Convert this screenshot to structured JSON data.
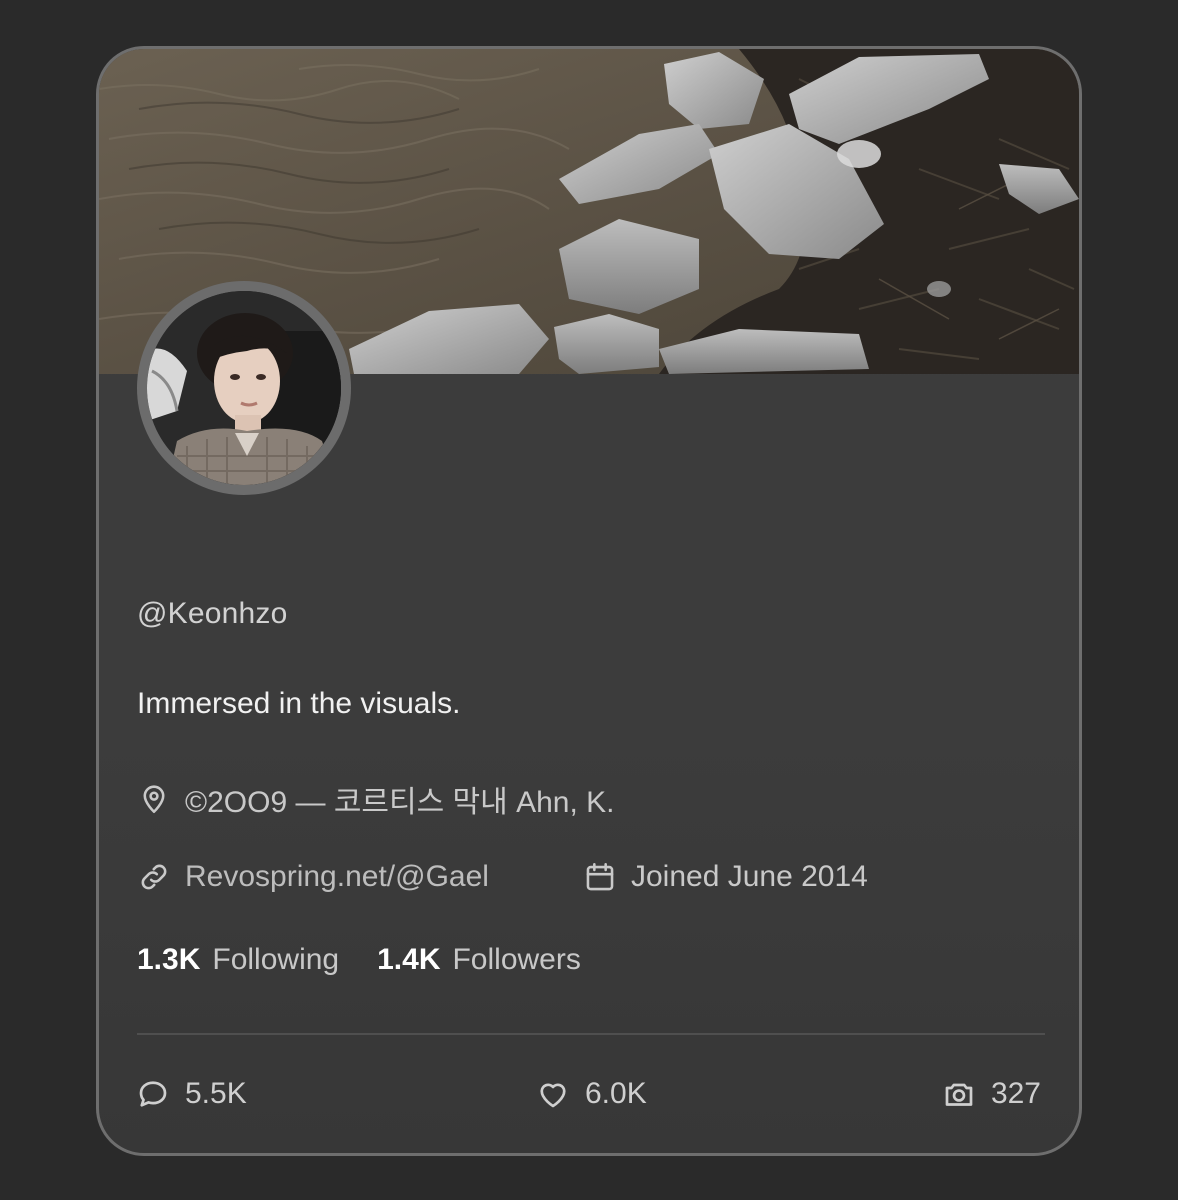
{
  "profile": {
    "handle": "@Keonhzo",
    "bio": "Immersed in the visuals.",
    "location": "©2OO9 — 코르티스 막내 Ahn, K.",
    "website": "Revospring.net/@Gael",
    "joined": "Joined June 2014",
    "following_count": "1.3K",
    "following_label": "Following",
    "followers_count": "1.4K",
    "followers_label": "Followers"
  },
  "stats": {
    "replies": "5.5K",
    "likes": "6.0K",
    "photos": "327"
  },
  "icons": {
    "location": "map-pin-icon",
    "website": "link-icon",
    "joined": "calendar-icon",
    "replies": "speech-bubble-icon",
    "likes": "heart-icon",
    "photos": "camera-icon"
  },
  "colors": {
    "page_background": "#2a2a2a",
    "card_background": "#3c3c3c",
    "card_border": "#6e6e6e",
    "text_primary": "#f1f1f1",
    "text_secondary": "#c9c9c9"
  }
}
